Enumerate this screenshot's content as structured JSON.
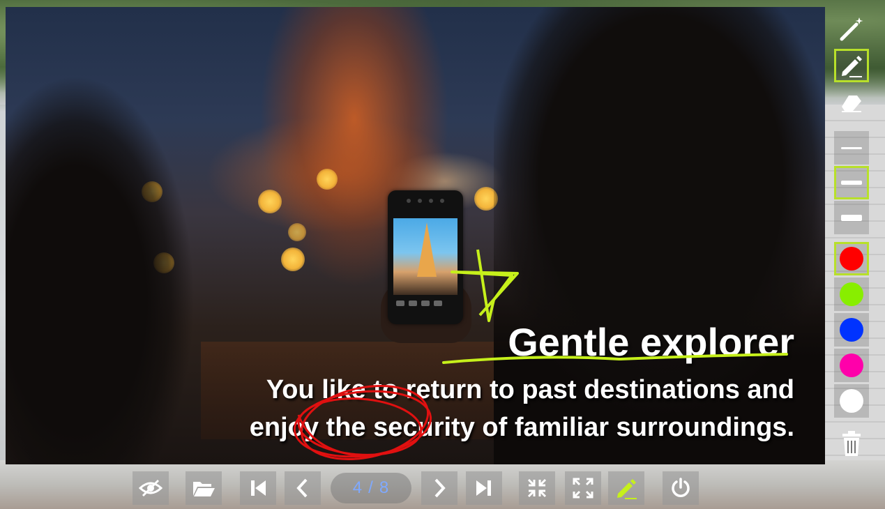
{
  "slide": {
    "title": "Gentle explorer",
    "body_line1": "You like to return to past destinations and",
    "body_line2": "enjoy the security of familiar surroundings."
  },
  "pager": {
    "current": "4",
    "separator": "/",
    "total": "8"
  },
  "tools": {
    "items": [
      {
        "name": "magic-wand-icon",
        "selected": false
      },
      {
        "name": "pen-icon",
        "selected": true
      },
      {
        "name": "eraser-icon",
        "selected": false
      },
      {
        "name": "line-width-thin",
        "selected": false
      },
      {
        "name": "line-width-medium",
        "selected": true
      },
      {
        "name": "line-width-thick",
        "selected": false
      },
      {
        "name": "color-red",
        "selected": true
      },
      {
        "name": "color-green",
        "selected": false
      },
      {
        "name": "color-blue",
        "selected": false
      },
      {
        "name": "color-magenta",
        "selected": false
      },
      {
        "name": "color-white",
        "selected": false
      },
      {
        "name": "trash-icon",
        "selected": false
      }
    ]
  },
  "colors": {
    "accent_selection": "#b8e02a",
    "pen_green": "#c6f01b",
    "pen_red": "#e01010",
    "swatch_red": "#ff0000",
    "swatch_green": "#88ee00",
    "swatch_blue": "#0033ff",
    "swatch_magenta": "#ff00aa",
    "swatch_white": "#ffffff",
    "pager_text": "#7fa9ff"
  },
  "toolbar": {
    "items": [
      "hide-icon",
      "folder-open-icon",
      "first-page-icon",
      "previous-icon",
      "next-icon",
      "last-page-icon",
      "shrink-icon",
      "expand-icon",
      "pen-toggle-icon",
      "power-icon"
    ]
  }
}
